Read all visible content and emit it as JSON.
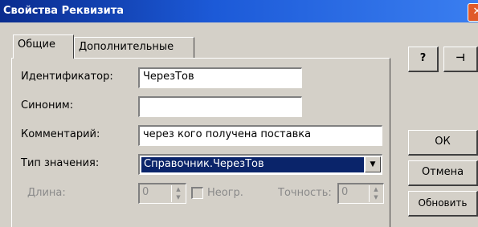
{
  "window": {
    "title": "Свойства Реквизита",
    "close_glyph": "✕"
  },
  "tabs": [
    {
      "label": "Общие",
      "active": true
    },
    {
      "label": "Дополнительные",
      "active": false
    }
  ],
  "form": {
    "identifier": {
      "label": "Идентификатор:",
      "value": "ЧерезТов"
    },
    "synonym": {
      "label": "Синоним:",
      "value": ""
    },
    "comment": {
      "label": "Комментарий:",
      "value": "через кого получена поставка"
    },
    "type": {
      "label": "Тип значения:",
      "value": "Справочник.ЧерезТов"
    },
    "length": {
      "label": "Длина:",
      "value": "0"
    },
    "unlimited": {
      "label": "Неогр.",
      "checked": false
    },
    "precision": {
      "label": "Точность:",
      "value": "0"
    }
  },
  "toolbar": {
    "help_glyph": "?",
    "pin_glyph": "⊣"
  },
  "buttons": {
    "ok": "ОК",
    "cancel": "Отмена",
    "refresh": "Обновить"
  }
}
